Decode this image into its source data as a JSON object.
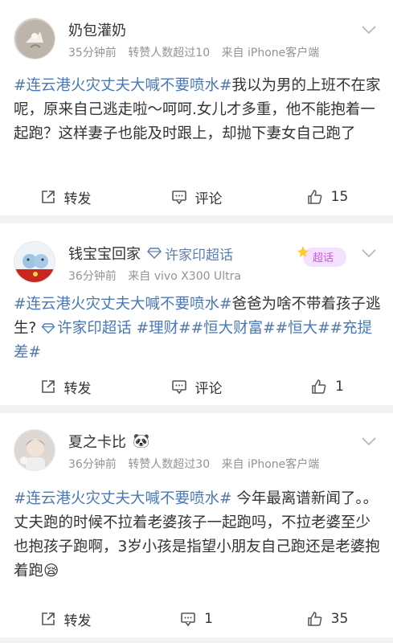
{
  "posts": [
    {
      "user_name": "奶包灌奶",
      "meta": [
        "35分钟前",
        "转赞人数超过10",
        "来自 iPhone客户端"
      ],
      "text_tag": "#连云港火灾丈夫大喊不要喷水#",
      "text_body": "我以为男的上班不在家呢，原来自己逃走啦～呵呵.女儿才多重，他不能抱着一起跑？这样妻子也能及时跟上，却抛下妻女自己跑了",
      "repost_label": "转发",
      "comment_label": "评论",
      "like_count": "15"
    },
    {
      "user_name": "钱宝宝回家",
      "topic_badge": "许家印超话",
      "sticker_label": "超话",
      "meta": [
        "36分钟前",
        "来自 vivo X300 Ultra"
      ],
      "text_tag": "#连云港火灾丈夫大喊不要喷水#",
      "text_body": "爸爸为啥不带着孩子逃生?",
      "text_topic": "许家印超话",
      "text_tags2": "#理财##恒大财富##恒大##充提差#",
      "repost_label": "转发",
      "comment_label": "评论",
      "like_count": "1"
    },
    {
      "user_name": "夏之卡比",
      "name_emoji": "🐼",
      "meta": [
        "36分钟前",
        "转赞人数超过30",
        "来自 iPhone客户端"
      ],
      "text_tag": "#连云港火灾丈夫大喊不要喷水#",
      "text_body": " 今年最离谱新闻了。。丈夫跑的时候不拉着老婆孩子一起跑吗，不拉老婆至少也抱孩子跑啊，3岁小孩是指望小朋友自己跑还是老婆抱着跑😪",
      "repost_label": "转发",
      "comment_count": "1",
      "like_count": "35"
    }
  ]
}
